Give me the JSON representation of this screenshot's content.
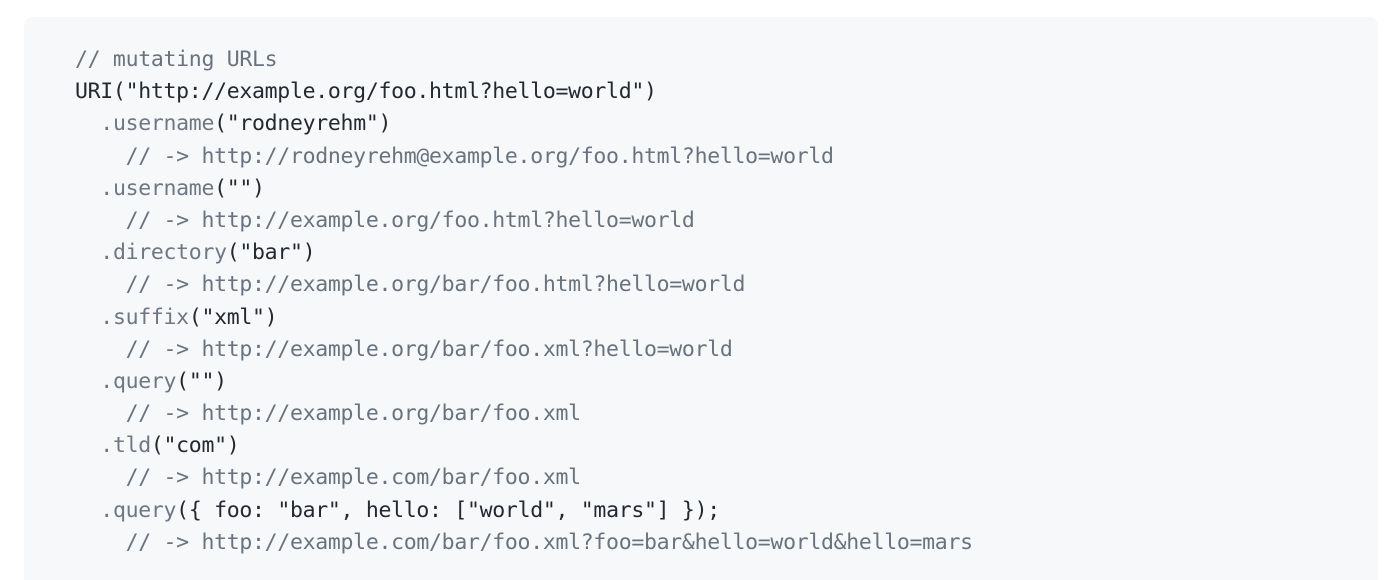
{
  "code": {
    "lines": [
      {
        "type": "comment",
        "indent": "",
        "text": "// mutating URLs"
      },
      {
        "type": "plain",
        "indent": "",
        "text": "URI(\"http://example.org/foo.html?hello=world\")"
      },
      {
        "type": "call",
        "indent": "  ",
        "method": ".username",
        "args": "(\"rodneyrehm\")"
      },
      {
        "type": "comment",
        "indent": "    ",
        "text": "// -> http://rodneyrehm@example.org/foo.html?hello=world"
      },
      {
        "type": "call",
        "indent": "  ",
        "method": ".username",
        "args": "(\"\")"
      },
      {
        "type": "comment",
        "indent": "    ",
        "text": "// -> http://example.org/foo.html?hello=world"
      },
      {
        "type": "call",
        "indent": "  ",
        "method": ".directory",
        "args": "(\"bar\")"
      },
      {
        "type": "comment",
        "indent": "    ",
        "text": "// -> http://example.org/bar/foo.html?hello=world"
      },
      {
        "type": "call",
        "indent": "  ",
        "method": ".suffix",
        "args": "(\"xml\")"
      },
      {
        "type": "comment",
        "indent": "    ",
        "text": "// -> http://example.org/bar/foo.xml?hello=world"
      },
      {
        "type": "call",
        "indent": "  ",
        "method": ".query",
        "args": "(\"\")"
      },
      {
        "type": "comment",
        "indent": "    ",
        "text": "// -> http://example.org/bar/foo.xml"
      },
      {
        "type": "call",
        "indent": "  ",
        "method": ".tld",
        "args": "(\"com\")"
      },
      {
        "type": "comment",
        "indent": "    ",
        "text": "// -> http://example.com/bar/foo.xml"
      },
      {
        "type": "call",
        "indent": "  ",
        "method": ".query",
        "args": "({ foo: \"bar\", hello: [\"world\", \"mars\"] });"
      },
      {
        "type": "comment",
        "indent": "    ",
        "text": "// -> http://example.com/bar/foo.xml?foo=bar&hello=world&hello=mars"
      }
    ]
  }
}
